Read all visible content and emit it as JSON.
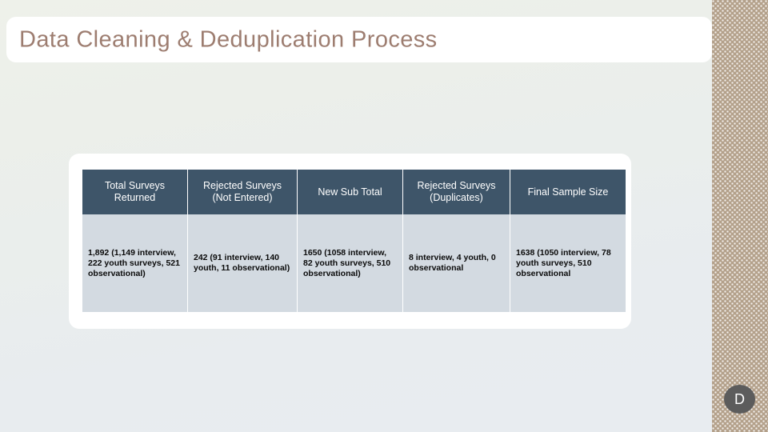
{
  "slide": {
    "title": "Data Cleaning & Deduplication Process",
    "accent_color": "#9d7d70",
    "header_color": "#3e5569",
    "cell_color": "#d3dae1",
    "band_color": "#b3a08a"
  },
  "table": {
    "headers": [
      "Total Surveys Returned",
      "Rejected Surveys (Not Entered)",
      "New Sub Total",
      "Rejected Surveys (Duplicates)",
      "Final Sample Size"
    ],
    "header_lines": [
      [
        "Total Surveys",
        "Returned"
      ],
      [
        "Rejected Surveys",
        "(Not Entered)"
      ],
      [
        "New Sub Total",
        ""
      ],
      [
        "Rejected Surveys",
        "(Duplicates)"
      ],
      [
        "Final Sample Size",
        ""
      ]
    ],
    "rows": [
      [
        "1,892 (1,149 interview, 222 youth surveys, 521 observational)",
        "242 (91 interview, 140 youth, 11 observational)",
        "1650 (1058 interview, 82 youth surveys, 510 observational)",
        "8 interview, 4 youth, 0 observational",
        "1638 (1050 interview, 78 youth surveys, 510 observational"
      ]
    ]
  },
  "badge": {
    "label": "D"
  }
}
